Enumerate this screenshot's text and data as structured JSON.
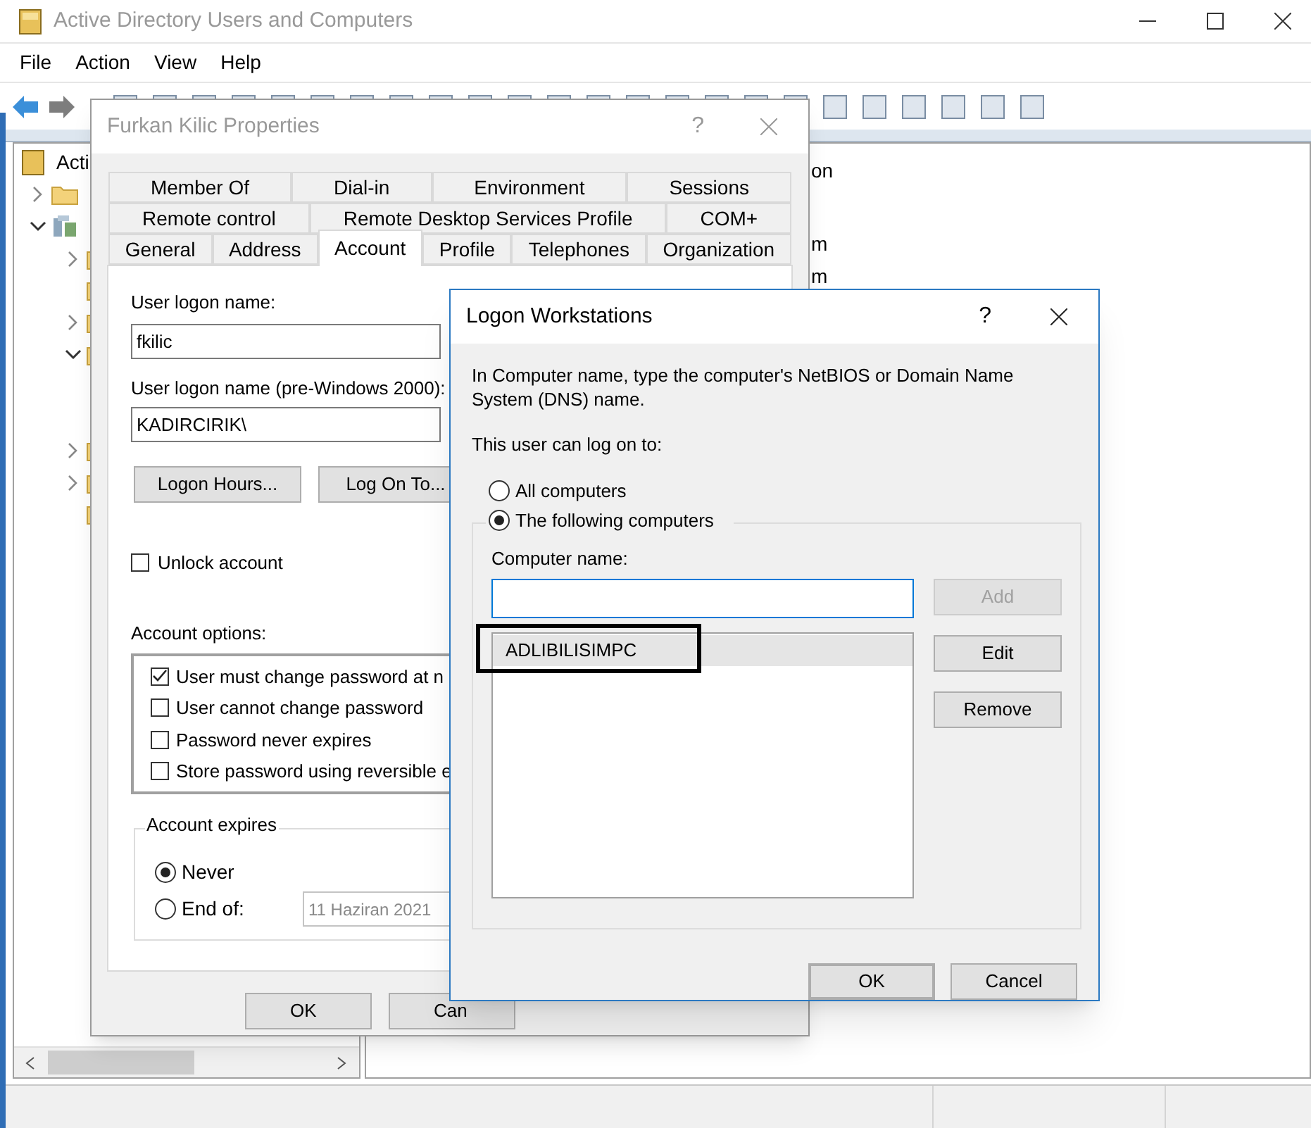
{
  "window": {
    "title": "Active Directory Users and Computers"
  },
  "menu": [
    {
      "label": "File"
    },
    {
      "label": "Action"
    },
    {
      "label": "View"
    },
    {
      "label": "Help"
    }
  ],
  "tree": {
    "label": "Acti",
    "children": [
      {
        "kind": "folder",
        "expanded": false
      },
      {
        "kind": "domain",
        "expanded": true,
        "children": [
          {
            "kind": "folder",
            "expanded": false
          },
          {
            "kind": "folder"
          },
          {
            "kind": "folder",
            "expanded": false
          },
          {
            "kind": "folder",
            "expanded": true
          },
          {
            "kind": "folder",
            "expanded": false
          },
          {
            "kind": "folder",
            "expanded": false
          },
          {
            "kind": "folder"
          }
        ]
      }
    ]
  },
  "list": {
    "rows": [
      {
        "text": "on"
      },
      {
        "text": "m"
      },
      {
        "text": "m"
      }
    ]
  },
  "properties_dialog": {
    "title": "Furkan Kilic Properties",
    "help": "?",
    "tab_rows": [
      [
        {
          "label": "Member Of",
          "selected": false
        },
        {
          "label": "Dial-in",
          "selected": false
        },
        {
          "label": "Environment",
          "selected": false
        },
        {
          "label": "Sessions",
          "selected": false
        }
      ],
      [
        {
          "label": "Remote control",
          "selected": false
        },
        {
          "label": "Remote Desktop Services Profile",
          "selected": false
        },
        {
          "label": "COM+",
          "selected": false
        }
      ],
      [
        {
          "label": "General",
          "selected": false
        },
        {
          "label": "Address",
          "selected": false
        },
        {
          "label": "Account",
          "selected": true
        },
        {
          "label": "Profile",
          "selected": false
        },
        {
          "label": "Telephones",
          "selected": false
        },
        {
          "label": "Organization",
          "selected": false
        }
      ]
    ],
    "logon_name_label": "User logon name:",
    "logon_name": "fkilic",
    "pre2000_label": "User logon name (pre-Windows 2000):",
    "pre2000_name": "KADIRCIRIK\\",
    "buttons_top": [
      "Logon Hours...",
      "Log On To..."
    ],
    "unlock": {
      "label": "Unlock account",
      "checked": false
    },
    "options_label": "Account options:",
    "options": [
      {
        "label": "User must change password at n",
        "checked": true
      },
      {
        "label": "User cannot change password",
        "checked": false
      },
      {
        "label": "Password never expires",
        "checked": false
      },
      {
        "label": "Store password using reversible e",
        "checked": false
      }
    ],
    "expires_label": "Account expires",
    "expires": [
      {
        "label": "Never",
        "selected": true
      },
      {
        "label": "End of:",
        "selected": false
      }
    ],
    "end_date": "11 Haziran 2021",
    "buttons": [
      "OK",
      "Can"
    ]
  },
  "logon_dialog": {
    "title": "Logon Workstations",
    "help": "?",
    "description": "In Computer name, type the computer's NetBIOS or Domain Name System (DNS) name.",
    "prompt": "This user can log on to:",
    "choices": [
      {
        "label": "All computers",
        "selected": false
      },
      {
        "label": "The following computers",
        "selected": true
      }
    ],
    "computer_name_label": "Computer name:",
    "computers": [
      {
        "name": "ADLIBILISIMPC",
        "selected": true
      }
    ],
    "side_buttons": [
      {
        "label": "Add",
        "disabled": true
      },
      {
        "label": "Edit",
        "disabled": false
      },
      {
        "label": "Remove",
        "disabled": false
      }
    ],
    "buttons": [
      {
        "label": "OK",
        "default": true
      },
      {
        "label": "Cancel",
        "default": false
      }
    ]
  }
}
